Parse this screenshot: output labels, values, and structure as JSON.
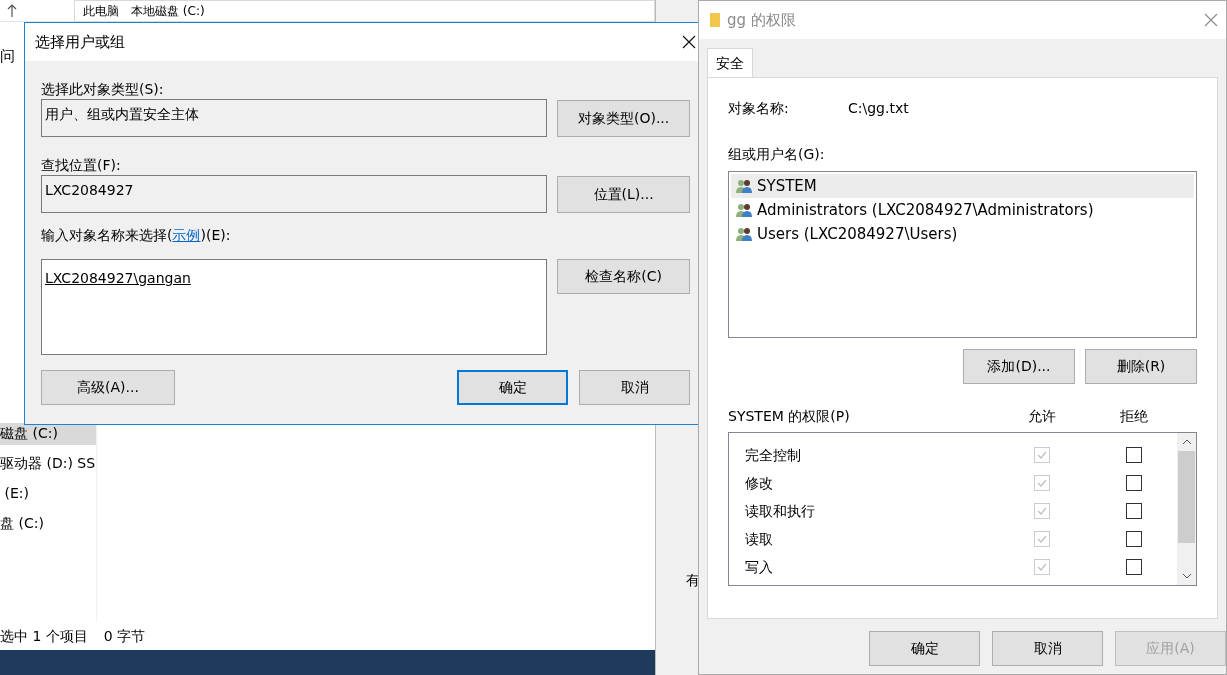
{
  "explorer": {
    "breadcrumb": [
      "此电脑",
      "本地磁盘 (C:)"
    ],
    "side_label": "问",
    "nav_items": [
      {
        "label": "磁盘 (C:)",
        "selected": true
      },
      {
        "label": "驱动器 (D:) SS",
        "selected": false
      },
      {
        "label": " (E:)",
        "selected": false
      },
      {
        "label": "盘 (C:)",
        "selected": false
      }
    ],
    "status": [
      "选中 1 个项目",
      "0 字节"
    ]
  },
  "background_window": {
    "text": "有"
  },
  "select_dialog": {
    "title": "选择用户或组",
    "object_type": {
      "label": "选择此对象类型(S):",
      "value": "用户、组或内置安全主体",
      "button": "对象类型(O)..."
    },
    "location": {
      "label": "查找位置(F):",
      "value": "LXC2084927",
      "button": "位置(L)..."
    },
    "names": {
      "label_before": "输入对象名称来选择(",
      "link": "示例",
      "label_after": ")(E):",
      "value": "LXC2084927\\gangan",
      "button": "检查名称(C)"
    },
    "buttons": [
      {
        "label": "高级(A)...",
        "default": false
      },
      {
        "label": "确定",
        "default": true
      },
      {
        "label": "取消",
        "default": false
      }
    ]
  },
  "permissions_dialog": {
    "title": "gg 的权限",
    "tabs": [
      {
        "label": "安全",
        "selected": true
      }
    ],
    "object_name": {
      "label": "对象名称:",
      "value": "C:\\gg.txt"
    },
    "group_label": "组或用户名(G):",
    "principals": [
      {
        "name": "SYSTEM",
        "selected": true
      },
      {
        "name": "Administrators (LXC2084927\\Administrators)",
        "selected": false
      },
      {
        "name": "Users (LXC2084927\\Users)",
        "selected": false
      }
    ],
    "principal_buttons": [
      "添加(D)...",
      "删除(R)"
    ],
    "permissions_label": "SYSTEM 的权限(P)",
    "columns": [
      "允许",
      "拒绝"
    ],
    "permissions": [
      {
        "label": "完全控制",
        "allow": {
          "checked": true,
          "disabled": true
        },
        "deny": {
          "checked": false,
          "disabled": false
        }
      },
      {
        "label": "修改",
        "allow": {
          "checked": true,
          "disabled": true
        },
        "deny": {
          "checked": false,
          "disabled": false
        }
      },
      {
        "label": "读取和执行",
        "allow": {
          "checked": true,
          "disabled": true
        },
        "deny": {
          "checked": false,
          "disabled": false
        }
      },
      {
        "label": "读取",
        "allow": {
          "checked": true,
          "disabled": true
        },
        "deny": {
          "checked": false,
          "disabled": false
        }
      },
      {
        "label": "写入",
        "allow": {
          "checked": true,
          "disabled": true
        },
        "deny": {
          "checked": false,
          "disabled": false
        }
      }
    ],
    "buttons": [
      {
        "label": "确定",
        "disabled": false
      },
      {
        "label": "取消",
        "disabled": false
      },
      {
        "label": "应用(A)",
        "disabled": true
      }
    ]
  }
}
